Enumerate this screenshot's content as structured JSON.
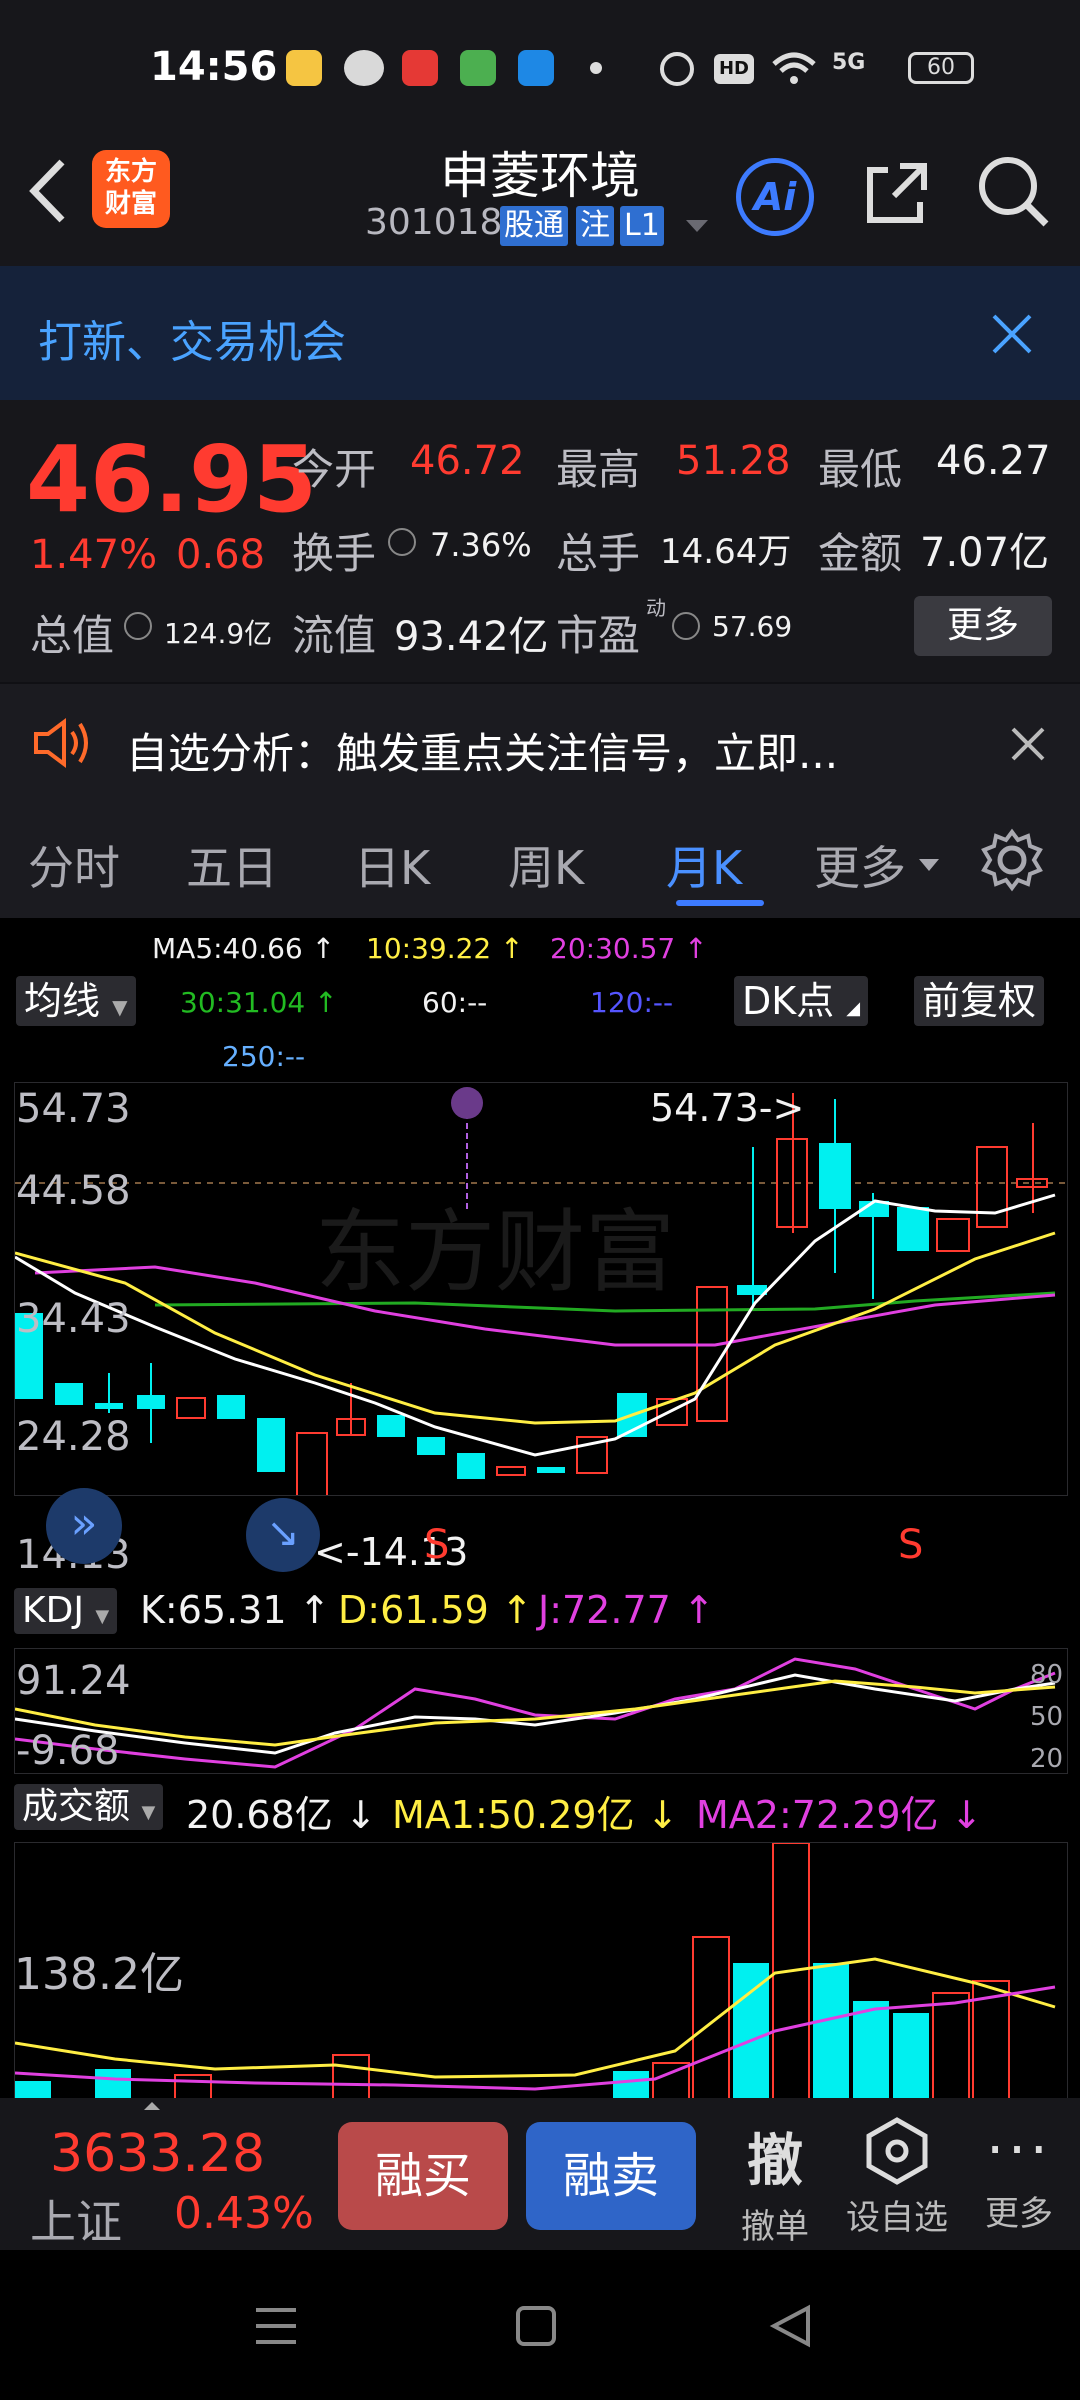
{
  "status": {
    "time": "14:56",
    "battery": "60",
    "network": "5G"
  },
  "header": {
    "title": "申菱环境",
    "code": "301018",
    "tags": [
      "股通",
      "注",
      "L1"
    ],
    "ai_label": "Ai"
  },
  "banner": {
    "text": "打新、交易机会"
  },
  "quote": {
    "price": "46.95",
    "change_pct": "1.47%",
    "change": "0.68",
    "open_label": "今开",
    "open": "46.72",
    "high_label": "最高",
    "high": "51.28",
    "low_label": "最低",
    "low": "46.27",
    "turnover_label": "换手",
    "turnover": "7.36%",
    "volume_label": "总手",
    "volume": "14.64万",
    "amount_label": "金额",
    "amount": "7.07亿",
    "mcap_label": "总值",
    "mcap": "124.9亿",
    "float_label": "流值",
    "float": "93.42亿",
    "pe_label": "市盈",
    "pe_sup": "动",
    "pe": "57.69",
    "more": "更多"
  },
  "notice": {
    "text": "自选分析：触发重点关注信号，立即..."
  },
  "tabs": [
    "分时",
    "五日",
    "日K",
    "周K",
    "月K",
    "更多"
  ],
  "chart": {
    "ma_button": "均线",
    "dk_button": "DK点",
    "fq_button": "前复权",
    "ma5": "MA5:40.66",
    "ma10": "10:39.22",
    "ma20": "20:30.57",
    "ma30": "30:31.04",
    "ma60": "60:--",
    "ma120": "120:--",
    "ma250": "250:--",
    "price_axis": [
      "54.73",
      "44.58",
      "34.43",
      "24.28",
      "14.13"
    ],
    "high_marker": "54.73->",
    "low_marker": "<-14.13",
    "signal_s": "S",
    "kdj_button": "KDJ",
    "kdj_k": "K:65.31",
    "kdj_d": "D:61.59",
    "kdj_j": "J:72.77",
    "kdj_axis_top": "91.24",
    "kdj_axis_bottom": "-9.68",
    "kdj_levels": [
      "80",
      "50",
      "20"
    ],
    "vol_button": "成交额",
    "vol_value": "20.68亿",
    "vol_ma1": "MA1:50.29亿",
    "vol_ma2": "MA2:72.29亿",
    "vol_axis_top": "138.2亿",
    "colors": {
      "up": "#ff3b30",
      "down": "#00f0f0",
      "ma5": "#ffffff",
      "ma10": "#ffee44",
      "ma20": "#e040e0",
      "ma30": "#22aa22"
    }
  },
  "bottom": {
    "index_value": "3633.28",
    "index_name": "上证",
    "index_pct": "0.43%",
    "buy": "融买",
    "sell": "融卖",
    "cancel_icon": "撤",
    "cancel": "撤单",
    "watch": "设自选",
    "more": "更多"
  }
}
